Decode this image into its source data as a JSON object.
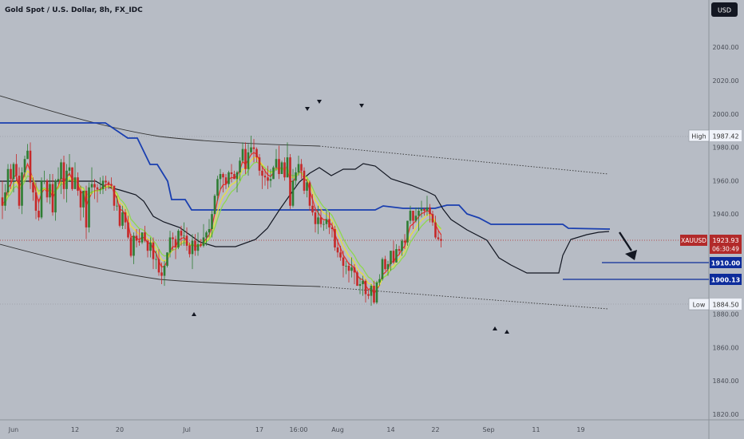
{
  "header": {
    "title": "Gold Spot / U.S. Dollar, 8h, FX_IDC",
    "currency_button": "USD"
  },
  "chart_data": {
    "type": "candlestick",
    "symbol": "XAUUSD",
    "yaxis": {
      "ticks": [
        2040,
        2020,
        2000,
        1980,
        1960,
        1940,
        1920,
        1900,
        1880,
        1860,
        1840,
        1820
      ],
      "tick_labels": [
        "2040.00",
        "2020.00",
        "2000.00",
        "1980.00",
        "1960.00",
        "1940.00",
        "1920.00",
        "1900.00",
        "1880.00",
        "1860.00",
        "1840.00",
        "1820.00"
      ]
    },
    "xaxis": {
      "tick_labels": [
        "Jun",
        "12",
        "20",
        "Jul",
        "17",
        "16:00",
        "Aug",
        "14",
        "22",
        "Sep",
        "11",
        "19"
      ],
      "tick_index": [
        0,
        22,
        38,
        62,
        88,
        102,
        116,
        135,
        151,
        170,
        187,
        203
      ]
    },
    "current_price": {
      "label": "XAUUSD",
      "value": "1923.93",
      "countdown": "06:30:49"
    },
    "high": {
      "label": "High",
      "value": "1987.42"
    },
    "low": {
      "label": "Low",
      "value": "1884.50"
    },
    "levels": [
      {
        "value": "1910.00",
        "start_index": 181
      },
      {
        "value": "1900.13",
        "start_index": 168
      }
    ],
    "candles": [
      [
        1950,
        1960,
        1937,
        1945
      ],
      [
        1945,
        1958,
        1942,
        1953
      ],
      [
        1953,
        1970,
        1951,
        1967
      ],
      [
        1967,
        1970,
        1955,
        1961
      ],
      [
        1961,
        1971,
        1953,
        1970
      ],
      [
        1970,
        1976,
        1960,
        1963
      ],
      [
        1963,
        1968,
        1943,
        1945
      ],
      [
        1945,
        1968,
        1940,
        1965
      ],
      [
        1965,
        1975,
        1962,
        1973
      ],
      [
        1973,
        1982,
        1973,
        1978
      ],
      [
        1978,
        1983,
        1955,
        1959
      ],
      [
        1959,
        1962,
        1948,
        1953
      ],
      [
        1953,
        1959,
        1937,
        1942
      ],
      [
        1942,
        1949,
        1936,
        1938
      ],
      [
        1938,
        1962,
        1937,
        1960
      ],
      [
        1960,
        1966,
        1958,
        1960
      ],
      [
        1960,
        1961,
        1947,
        1950
      ],
      [
        1950,
        1964,
        1946,
        1958
      ],
      [
        1958,
        1964,
        1939,
        1941
      ],
      [
        1941,
        1961,
        1936,
        1960
      ],
      [
        1960,
        1968,
        1958,
        1961
      ],
      [
        1961,
        1973,
        1952,
        1971
      ],
      [
        1971,
        1975,
        1949,
        1955
      ],
      [
        1955,
        1970,
        1947,
        1966
      ],
      [
        1966,
        1976,
        1963,
        1968
      ],
      [
        1968,
        1968,
        1954,
        1955
      ],
      [
        1955,
        1971,
        1955,
        1962
      ],
      [
        1962,
        1965,
        1951,
        1954
      ],
      [
        1954,
        1957,
        1936,
        1944
      ],
      [
        1944,
        1954,
        1938,
        1954
      ],
      [
        1954,
        1957,
        1925,
        1932
      ],
      [
        1932,
        1959,
        1929,
        1956
      ],
      [
        1956,
        1968,
        1952,
        1958
      ],
      [
        1958,
        1961,
        1949,
        1956
      ],
      [
        1956,
        1958,
        1947,
        1955
      ],
      [
        1955,
        1962,
        1952,
        1955
      ],
      [
        1955,
        1963,
        1952,
        1960
      ],
      [
        1960,
        1963,
        1954,
        1959
      ],
      [
        1959,
        1960,
        1955,
        1958
      ],
      [
        1958,
        1962,
        1955,
        1957
      ],
      [
        1957,
        1957,
        1942,
        1945
      ],
      [
        1945,
        1951,
        1942,
        1945
      ],
      [
        1945,
        1946,
        1932,
        1933
      ],
      [
        1933,
        1945,
        1931,
        1941
      ],
      [
        1941,
        1943,
        1931,
        1935
      ],
      [
        1935,
        1939,
        1925,
        1926
      ],
      [
        1926,
        1928,
        1914,
        1915
      ],
      [
        1915,
        1929,
        1910,
        1927
      ],
      [
        1927,
        1931,
        1920,
        1924
      ],
      [
        1924,
        1931,
        1921,
        1923
      ],
      [
        1923,
        1929,
        1922,
        1929
      ],
      [
        1929,
        1933,
        1923,
        1924
      ],
      [
        1924,
        1925,
        1914,
        1918
      ],
      [
        1918,
        1926,
        1914,
        1923
      ],
      [
        1923,
        1926,
        1907,
        1913
      ],
      [
        1913,
        1918,
        1907,
        1913
      ],
      [
        1913,
        1919,
        1903,
        1905
      ],
      [
        1905,
        1911,
        1898,
        1903
      ],
      [
        1903,
        1912,
        1897,
        1909
      ],
      [
        1909,
        1917,
        1908,
        1917
      ],
      [
        1917,
        1930,
        1914,
        1926
      ],
      [
        1926,
        1929,
        1918,
        1925
      ],
      [
        1925,
        1927,
        1913,
        1920
      ],
      [
        1920,
        1931,
        1919,
        1930
      ],
      [
        1930,
        1933,
        1921,
        1927
      ],
      [
        1927,
        1935,
        1921,
        1927
      ],
      [
        1927,
        1932,
        1918,
        1921
      ],
      [
        1921,
        1923,
        1914,
        1916
      ],
      [
        1916,
        1928,
        1907,
        1924
      ],
      [
        1924,
        1928,
        1915,
        1918
      ],
      [
        1918,
        1929,
        1915,
        1922
      ],
      [
        1922,
        1925,
        1920,
        1921
      ],
      [
        1921,
        1934,
        1920,
        1926
      ],
      [
        1926,
        1930,
        1921,
        1929
      ],
      [
        1929,
        1937,
        1926,
        1931
      ],
      [
        1931,
        1942,
        1926,
        1940
      ],
      [
        1940,
        1952,
        1940,
        1951
      ],
      [
        1951,
        1963,
        1948,
        1961
      ],
      [
        1961,
        1967,
        1955,
        1964
      ],
      [
        1964,
        1965,
        1953,
        1962
      ],
      [
        1962,
        1964,
        1955,
        1958
      ],
      [
        1958,
        1966,
        1956,
        1965
      ],
      [
        1965,
        1970,
        1959,
        1964
      ],
      [
        1964,
        1966,
        1961,
        1961
      ],
      [
        1961,
        1966,
        1953,
        1965
      ],
      [
        1965,
        1974,
        1960,
        1972
      ],
      [
        1972,
        1983,
        1971,
        1979
      ],
      [
        1979,
        1983,
        1964,
        1967
      ],
      [
        1967,
        1982,
        1963,
        1977
      ],
      [
        1977,
        1987,
        1976,
        1980
      ],
      [
        1980,
        1985,
        1971,
        1979
      ],
      [
        1979,
        1980,
        1971,
        1974
      ],
      [
        1974,
        1976,
        1963,
        1966
      ],
      [
        1966,
        1969,
        1955,
        1963
      ],
      [
        1963,
        1967,
        1957,
        1962
      ],
      [
        1962,
        1969,
        1955,
        1960
      ],
      [
        1960,
        1967,
        1956,
        1961
      ],
      [
        1961,
        1969,
        1961,
        1968
      ],
      [
        1968,
        1979,
        1966,
        1973
      ],
      [
        1973,
        1981,
        1961,
        1964
      ],
      [
        1964,
        1972,
        1964,
        1971
      ],
      [
        1971,
        1974,
        1960,
        1962
      ],
      [
        1962,
        1983,
        1962,
        1974
      ],
      [
        1974,
        1976,
        1943,
        1945
      ],
      [
        1945,
        1967,
        1944,
        1960
      ],
      [
        1960,
        1968,
        1957,
        1965
      ],
      [
        1965,
        1975,
        1963,
        1970
      ],
      [
        1970,
        1973,
        1961,
        1966
      ],
      [
        1966,
        1968,
        1952,
        1954
      ],
      [
        1954,
        1961,
        1950,
        1959
      ],
      [
        1959,
        1960,
        1942,
        1945
      ],
      [
        1945,
        1952,
        1939,
        1941
      ],
      [
        1941,
        1944,
        1929,
        1934
      ],
      [
        1934,
        1945,
        1928,
        1938
      ],
      [
        1938,
        1943,
        1932,
        1934
      ],
      [
        1934,
        1936,
        1930,
        1934
      ],
      [
        1934,
        1942,
        1931,
        1937
      ],
      [
        1937,
        1941,
        1928,
        1932
      ],
      [
        1932,
        1935,
        1926,
        1931
      ],
      [
        1931,
        1933,
        1918,
        1920
      ],
      [
        1920,
        1925,
        1914,
        1917
      ],
      [
        1917,
        1921,
        1912,
        1914
      ],
      [
        1914,
        1918,
        1902,
        1909
      ],
      [
        1909,
        1912,
        1904,
        1909
      ],
      [
        1909,
        1911,
        1899,
        1906
      ],
      [
        1906,
        1914,
        1902,
        1908
      ],
      [
        1908,
        1910,
        1898,
        1905
      ],
      [
        1905,
        1906,
        1897,
        1897
      ],
      [
        1897,
        1902,
        1892,
        1898
      ],
      [
        1898,
        1903,
        1891,
        1900
      ],
      [
        1900,
        1901,
        1887,
        1892
      ],
      [
        1892,
        1895,
        1889,
        1891
      ],
      [
        1891,
        1898,
        1885,
        1897
      ],
      [
        1897,
        1900,
        1886,
        1887
      ],
      [
        1887,
        1900,
        1886,
        1899
      ],
      [
        1899,
        1904,
        1897,
        1901
      ],
      [
        1901,
        1914,
        1900,
        1913
      ],
      [
        1913,
        1915,
        1906,
        1907
      ],
      [
        1907,
        1912,
        1903,
        1910
      ],
      [
        1910,
        1918,
        1906,
        1918
      ],
      [
        1918,
        1924,
        1910,
        1911
      ],
      [
        1911,
        1922,
        1911,
        1919
      ],
      [
        1919,
        1921,
        1916,
        1918
      ],
      [
        1918,
        1925,
        1915,
        1924
      ],
      [
        1924,
        1928,
        1919,
        1923
      ],
      [
        1923,
        1936,
        1921,
        1936
      ],
      [
        1936,
        1945,
        1934,
        1942
      ],
      [
        1942,
        1942,
        1931,
        1936
      ],
      [
        1936,
        1944,
        1935,
        1939
      ],
      [
        1939,
        1944,
        1930,
        1942
      ],
      [
        1942,
        1948,
        1938,
        1943
      ],
      [
        1943,
        1944,
        1939,
        1942
      ],
      [
        1942,
        1951,
        1939,
        1944
      ],
      [
        1944,
        1946,
        1935,
        1940
      ],
      [
        1940,
        1942,
        1933,
        1935
      ],
      [
        1935,
        1939,
        1925,
        1926
      ],
      [
        1926,
        1930,
        1924,
        1925
      ],
      [
        1925,
        1928,
        1920,
        1924
      ]
    ]
  }
}
